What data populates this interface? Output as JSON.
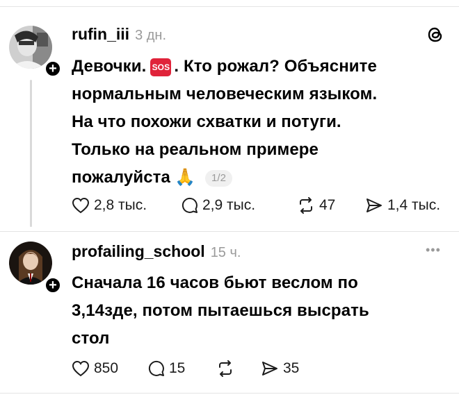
{
  "posts": [
    {
      "username": "rufin_iii",
      "time": "3 дн.",
      "text_line1_a": "Девочки.",
      "sos": "SOS",
      "text_line1_b": ". Кто рожал? Объясните",
      "text_line2": "нормальным человеческим языком.",
      "text_line3": "На что похожи схватки и потуги.",
      "text_line4": "Только на реальном примере",
      "text_line5": "пожалуйста",
      "pager": "1/2",
      "likes": "2,8 тыс.",
      "comments": "2,9 тыс.",
      "reposts": "47",
      "shares": "1,4 тыс."
    },
    {
      "username": "profailing_school",
      "time": "15 ч.",
      "text_line1": "Сначала 16 часов бьют веслом по",
      "text_line2": "3,14зде, потом пытаешься высрать",
      "text_line3": "стол",
      "likes": "850",
      "comments": "15",
      "reposts": "",
      "shares": "35"
    }
  ],
  "icons": {
    "heart": "heart-icon",
    "comment": "comment-icon",
    "repost": "repost-icon",
    "share": "share-icon",
    "logo": "threads-logo-icon",
    "more": "more-icon",
    "pray": "🙏"
  }
}
